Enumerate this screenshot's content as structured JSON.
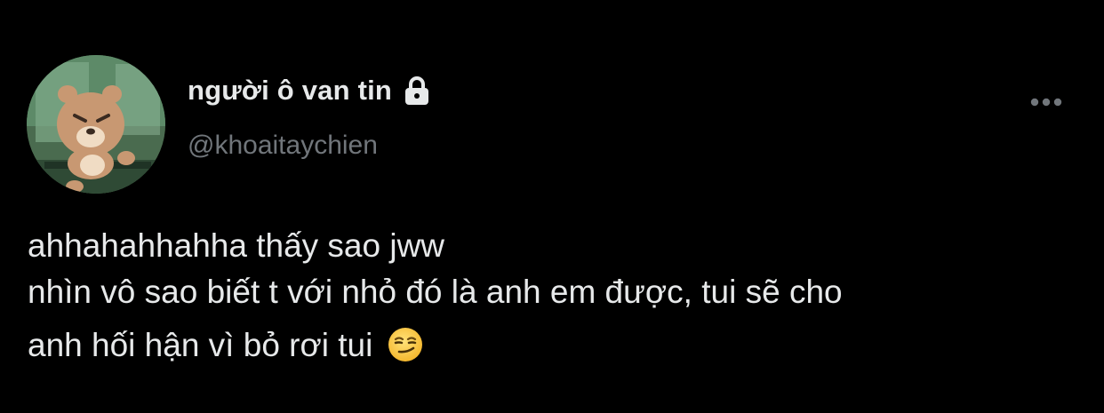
{
  "author": {
    "display_name": "người ô van tin",
    "handle": "@khoaitaychien",
    "protected_icon": "lock-icon",
    "avatar_icon": "bear-cartoon-avatar"
  },
  "tweet": {
    "line1": "ahhahahhahha thấy sao jww",
    "line2": "nhìn vô sao biết t với nhỏ đó là anh em được, tui sẽ cho",
    "line3": "anh hối hận vì bỏ rơi tui",
    "emoji": "smirking-face-emoji"
  },
  "menu": {
    "icon": "more-options-icon"
  },
  "colors": {
    "background": "#000000",
    "primary_text": "#e7e9ea",
    "secondary_text": "#71767b"
  }
}
